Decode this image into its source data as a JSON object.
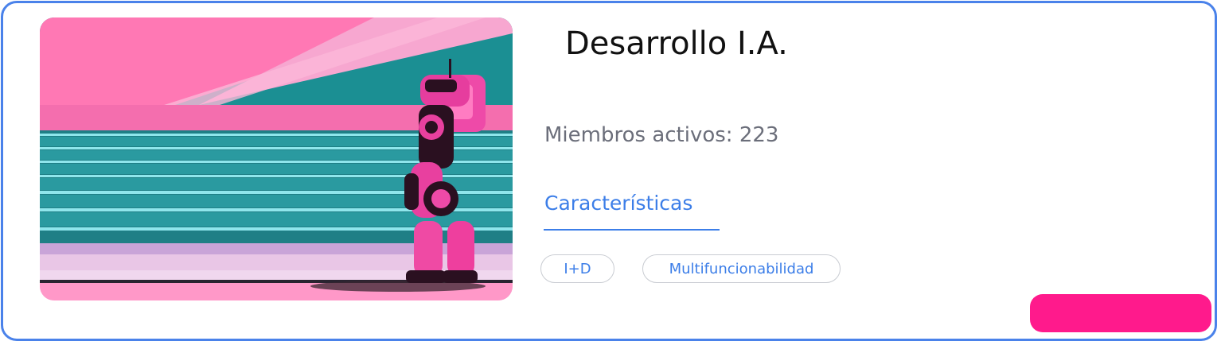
{
  "card": {
    "title": "Desarrollo I.A.",
    "members_label": "Miembros activos: ",
    "members_count": "223",
    "tab_label": "Características",
    "tags": [
      "I+D",
      "Multifuncionabilidad"
    ],
    "action_label": ""
  },
  "colors": {
    "border": "#4a82ea",
    "accent_blue": "#3c7ee8",
    "action_pink": "#ff1a8c",
    "muted_text": "#6b6e7a"
  },
  "image": {
    "subject": "pink robot standing on teal stairs",
    "icon": "robot-illustration"
  }
}
